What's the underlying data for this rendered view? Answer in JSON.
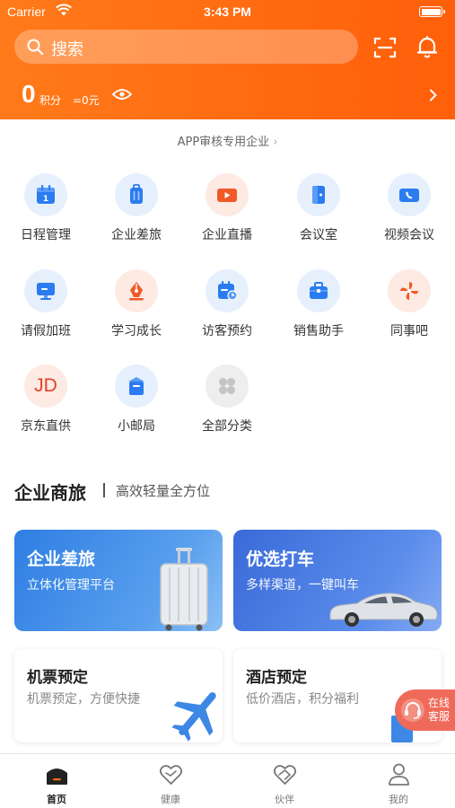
{
  "status_bar": {
    "carrier": "Carrier",
    "time": "3:43 PM"
  },
  "header": {
    "search_placeholder": "搜索",
    "points_value": "0",
    "points_unit": "积分",
    "points_yuan": "=0元"
  },
  "company": {
    "name": "APP审核专用企业",
    "chevron": "›"
  },
  "grid": [
    {
      "label": "日程管理",
      "icon": "calendar-icon"
    },
    {
      "label": "企业差旅",
      "icon": "suitcase-icon"
    },
    {
      "label": "企业直播",
      "icon": "live-video-icon"
    },
    {
      "label": "会议室",
      "icon": "door-icon"
    },
    {
      "label": "视频会议",
      "icon": "video-call-icon"
    },
    {
      "label": "请假加班",
      "icon": "monitor-icon"
    },
    {
      "label": "学习成长",
      "icon": "pen-nib-icon"
    },
    {
      "label": "访客预约",
      "icon": "visitor-calendar-icon"
    },
    {
      "label": "销售助手",
      "icon": "briefcase-icon"
    },
    {
      "label": "同事吧",
      "icon": "pinwheel-icon"
    },
    {
      "label": "京东直供",
      "icon": "jd-icon",
      "icon_text": "JD"
    },
    {
      "label": "小邮局",
      "icon": "mailbox-icon"
    },
    {
      "label": "全部分类",
      "icon": "all-categories-icon"
    }
  ],
  "section": {
    "title": "企业商旅",
    "subtitle": "高效轻量全方位"
  },
  "cards": {
    "travel": {
      "title": "企业差旅",
      "subtitle": "立体化管理平台"
    },
    "taxi": {
      "title": "优选打车",
      "subtitle": "多样渠道，一键叫车"
    },
    "flight": {
      "title": "机票预定",
      "subtitle": "机票预定，方便快捷"
    },
    "hotel": {
      "title": "酒店预定",
      "subtitle": "低价酒店，积分福利"
    }
  },
  "online_service": {
    "line1": "在线",
    "line2": "客服"
  },
  "tabbar": [
    {
      "label": "首页",
      "icon": "home-icon",
      "active": true
    },
    {
      "label": "健康",
      "icon": "heart-icon",
      "active": false
    },
    {
      "label": "伙伴",
      "icon": "partner-heart-icon",
      "active": false
    },
    {
      "label": "我的",
      "icon": "profile-icon",
      "active": false
    }
  ],
  "colors": {
    "brand_orange": "#ff6a12",
    "icon_blue": "#2b7cf0",
    "icon_orange": "#f05a28",
    "service_red": "#f06a5a"
  }
}
